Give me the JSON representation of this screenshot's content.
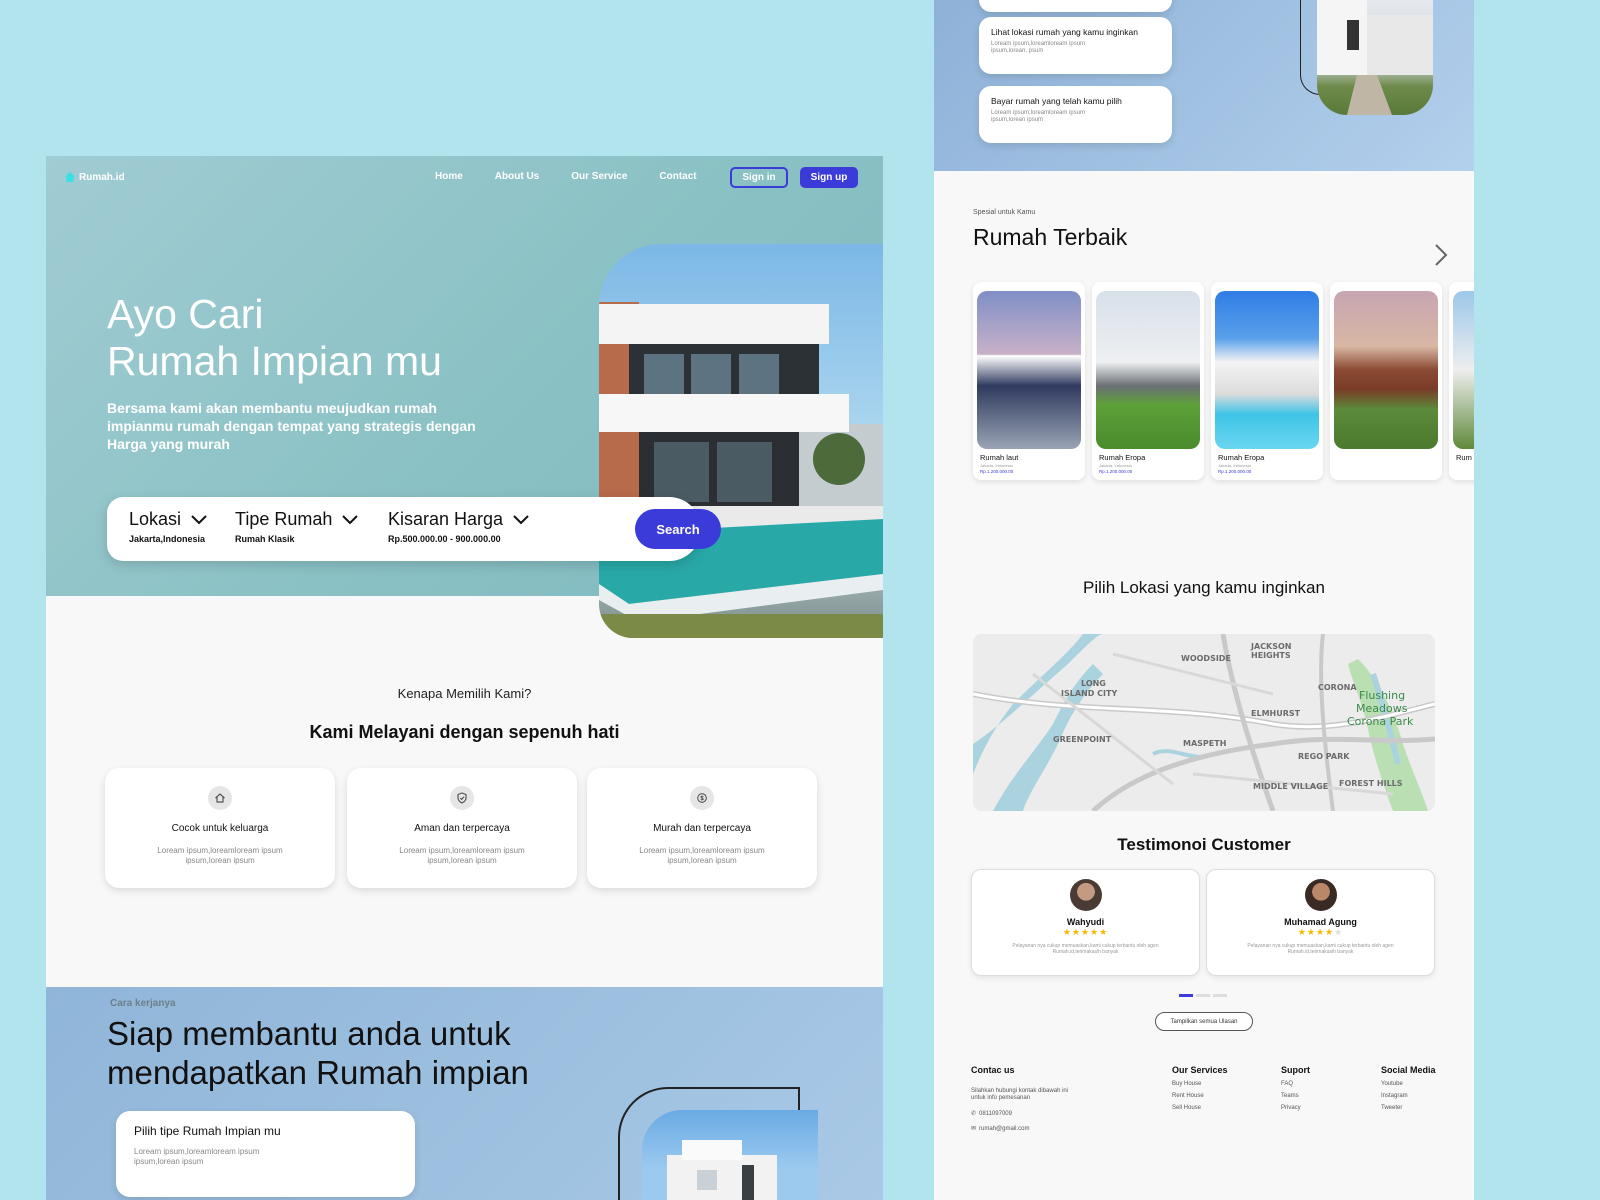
{
  "brand": {
    "name": "Rumah.id",
    "accent": "#3b3bd9"
  },
  "nav": {
    "links": [
      "Home",
      "About Us",
      "Our Service",
      "Contact"
    ],
    "signin": "Sign in",
    "signup": "Sign up"
  },
  "hero": {
    "title_line1": "Ayo Cari",
    "title_line2": "Rumah Impian mu",
    "subtitle": "Bersama kami akan membantu meujudkan rumah impianmu rumah dengan tempat yang strategis dengan Harga yang murah"
  },
  "search": {
    "location_label": "Lokasi",
    "location_value": "Jakarta,Indonesia",
    "type_label": "Tipe Rumah",
    "type_value": "Rumah Klasik",
    "price_label": "Kisaran Harga",
    "price_value": "Rp.500.000.00 - 900.000.00",
    "button": "Search"
  },
  "why": {
    "small": "Kenapa Memilih Kami?",
    "title": "Kami Melayani dengan sepenuh hati",
    "cards": [
      {
        "icon": "home-icon",
        "title": "Cocok untuk keluarga",
        "desc": "Loream ipsum,loreamloream ipsum ipsum,lorean ipsum"
      },
      {
        "icon": "shield-icon",
        "title": "Aman dan terpercaya",
        "desc": "Loream ipsum,loreamloream ipsum ipsum,lorean ipsum"
      },
      {
        "icon": "money-icon",
        "title": "Murah dan terpercaya",
        "desc": "Loream ipsum,loreamloream ipsum ipsum,lorean ipsum"
      }
    ]
  },
  "how": {
    "small": "Cara kerjanya",
    "title_line1": "Siap membantu anda untuk",
    "title_line2": "mendapatkan Rumah impian",
    "card_title": "Pilih tipe Rumah Impian mu",
    "card_desc": "Loream ipsum,loreamloream ipsum ipsum,lorean ipsum"
  },
  "steps": [
    {
      "title": "Lihat lokasi rumah yang kamu inginkan",
      "desc": "Loream ipsum,loreamloream ipsum ipsum,lorean, psum"
    },
    {
      "title": "Bayar rumah yang telah kamu pilih",
      "desc": "Loream ipsum,loreamloream ipsum ipsum,lorean ipsum"
    }
  ],
  "best": {
    "small": "Spesial untuk Kamu",
    "title": "Rumah Terbaik",
    "houses": [
      {
        "name": "Rumah laut",
        "sub": "Jakarta, Indonesia",
        "price": "Rp.1.200.000.00"
      },
      {
        "name": "Rumah Eropa",
        "sub": "Jakarta, Indonesia",
        "price": "Rp.1.200.000.00"
      },
      {
        "name": "Rumah Eropa",
        "sub": "Jakarta, Indonesia",
        "price": "Rp.1.200.000.00"
      },
      {
        "name": "",
        "sub": "",
        "price": ""
      },
      {
        "name": "Rum",
        "sub": "",
        "price": ""
      }
    ]
  },
  "location": {
    "title": "Pilih Lokasi yang kamu inginkan",
    "map_labels": [
      "WOODSIDE",
      "JACKSON",
      "HEIGHTS",
      "LONG",
      "ISLAND CITY",
      "CORONA",
      "ELMHURST",
      "Flushing",
      "Meadows",
      "Corona Park",
      "GREENPOINT",
      "MASPETH",
      "REGO PARK",
      "MIDDLE VILLAGE",
      "FOREST HILLS"
    ]
  },
  "testimonials": {
    "title": "Testimonoi Customer",
    "items": [
      {
        "name": "Wahyudi",
        "stars": 5,
        "desc": "Pelayanan nya cukup memuaskan,kami cukup terbantu oleh agen Rumah.id,terimakasih banyak"
      },
      {
        "name": "Muhamad Agung",
        "stars": 4,
        "desc": "Pelayanan nya cukup memuaskan,kami cukup terbantu oleh agen Rumah.id,terimakasih banyak"
      }
    ],
    "show_all": "Tampilkan semua Ulasan"
  },
  "footer": {
    "contact_title": "Contac us",
    "contact_desc": "Silahkan hubungi kontak dibawah ini untuk info pemesanan",
    "phone": "0811097009",
    "email": "rumah@gmail.com",
    "services_title": "Our Services",
    "services": [
      "Buy House",
      "Rent House",
      "Sell House"
    ],
    "support_title": "Suport",
    "support": [
      "FAQ",
      "Teams",
      "Privacy"
    ],
    "social_title": "Social Media",
    "social": [
      "Youtube",
      "Instagram",
      "Tweeter"
    ]
  }
}
